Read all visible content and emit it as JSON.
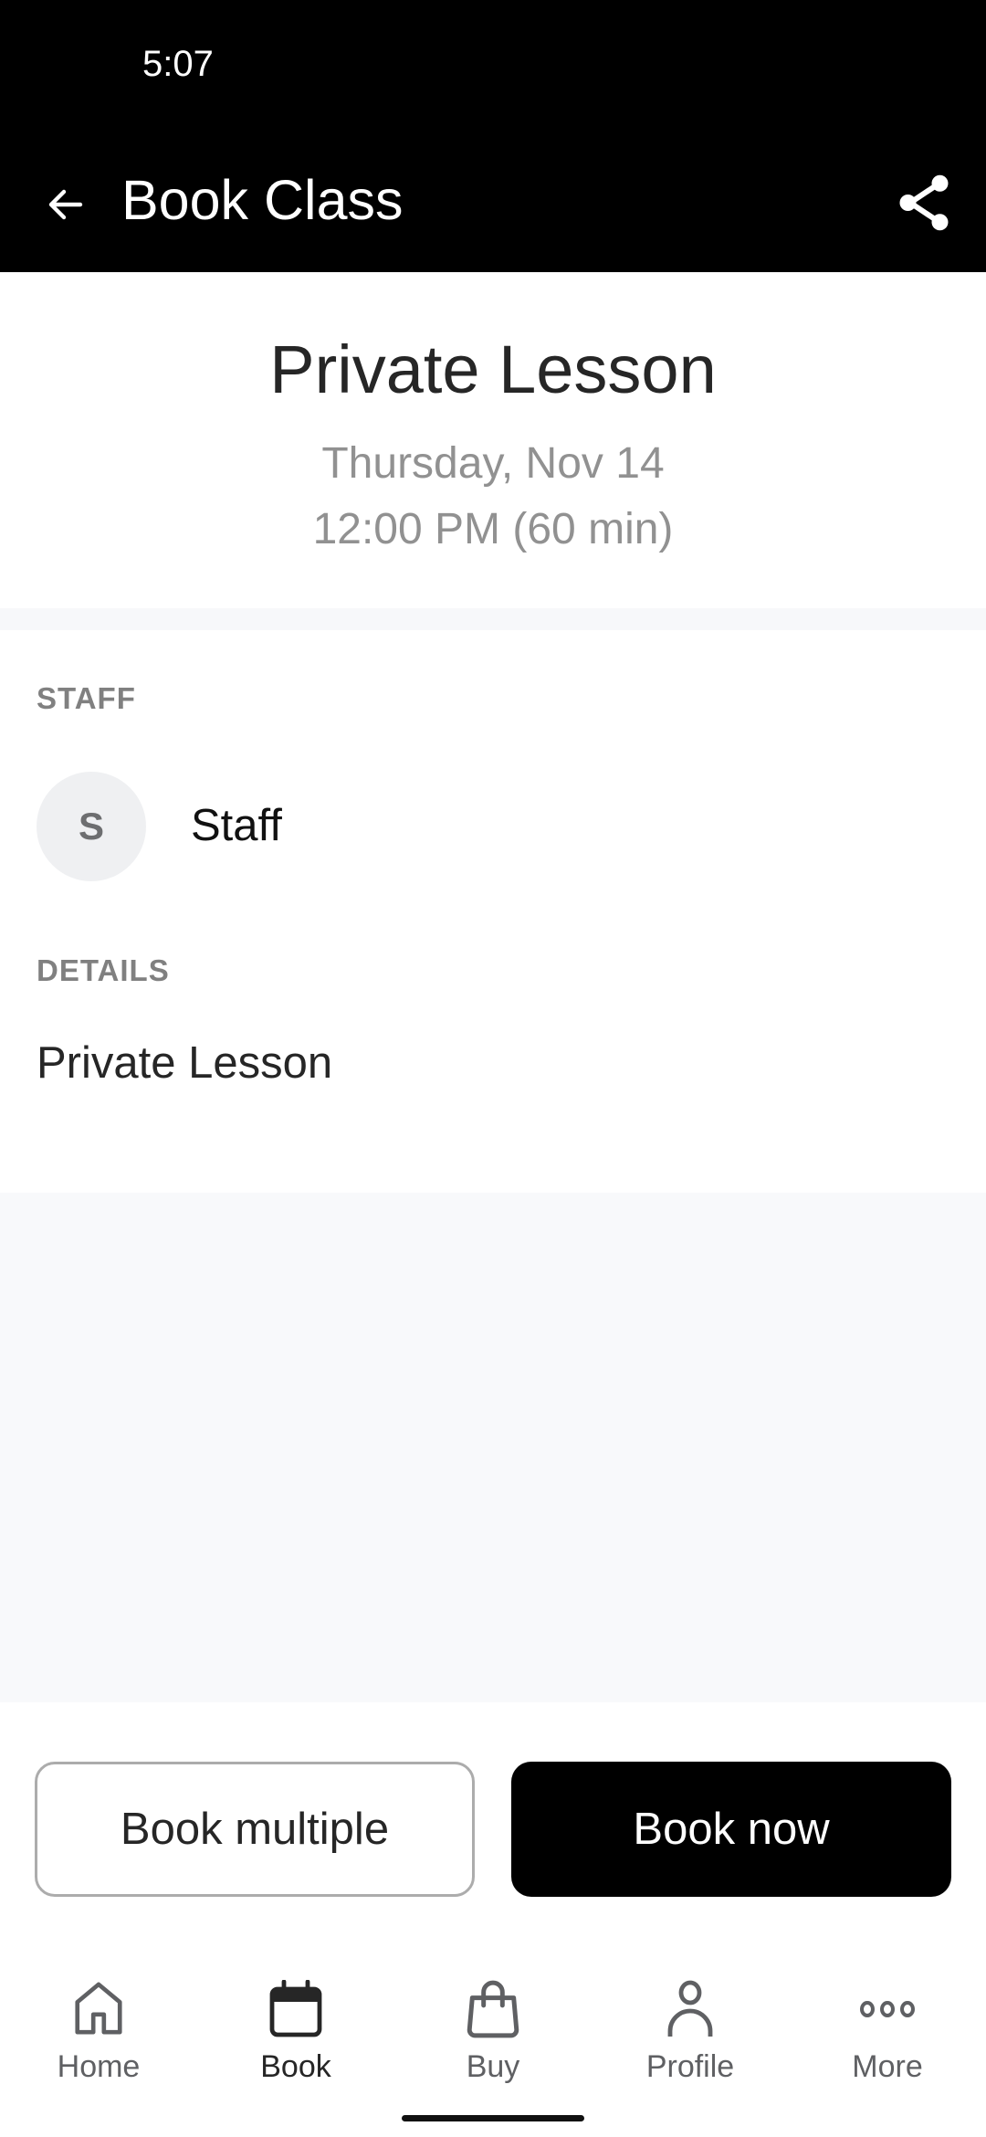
{
  "status_bar": {
    "time": "5:07"
  },
  "app_bar": {
    "title": "Book Class",
    "back_icon": "arrow-left-icon",
    "share_icon": "share-icon"
  },
  "class_info": {
    "name": "Private Lesson",
    "date": "Thursday, Nov 14",
    "time": "12:00 PM (60 min)"
  },
  "staff_section": {
    "label": "STAFF",
    "avatar_initial": "S",
    "name": "Staff"
  },
  "details_section": {
    "label": "DETAILS",
    "text": "Private Lesson"
  },
  "actions": {
    "book_multiple": "Book multiple",
    "book_now": "Book now"
  },
  "bottom_nav": {
    "items": [
      {
        "label": "Home",
        "icon": "home-icon",
        "active": false
      },
      {
        "label": "Book",
        "icon": "calendar-icon",
        "active": true
      },
      {
        "label": "Buy",
        "icon": "shopping-bag-icon",
        "active": false
      },
      {
        "label": "Profile",
        "icon": "person-icon",
        "active": false
      },
      {
        "label": "More",
        "icon": "more-dots-icon",
        "active": false
      }
    ]
  },
  "colors": {
    "app_bar_bg": "#000000",
    "primary_button": "#000000",
    "muted_text": "#919191",
    "section_label": "#808080",
    "filler_bg": "#f8f9fb"
  }
}
